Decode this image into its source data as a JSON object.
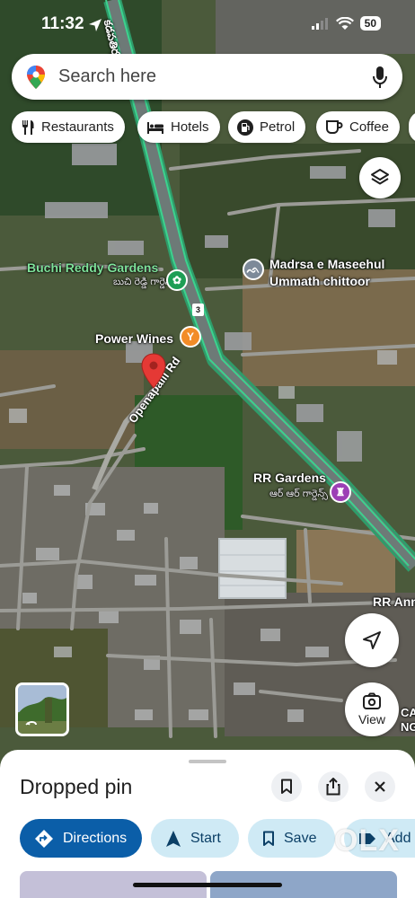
{
  "status_bar": {
    "time": "11:32",
    "battery": "50"
  },
  "search": {
    "placeholder": "Search here"
  },
  "chips": [
    {
      "label": "Restaurants",
      "icon": "fork-knife-icon"
    },
    {
      "label": "Hotels",
      "icon": "bed-icon"
    },
    {
      "label": "Petrol",
      "icon": "fuel-pump-icon"
    },
    {
      "label": "Coffee",
      "icon": "coffee-cup-icon"
    }
  ],
  "map": {
    "labels": {
      "buchi_reddy_gardens": "Buchi Reddy Gardens",
      "buchi_reddy_gardens_te": "బుచి రెడ్డి గార్డెన్స్",
      "madrsa_line1": "Madrsa e Maseehul",
      "madrsa_line2": "Ummath chittoor",
      "power_wines": "Power Wines",
      "openapalli_rd": "Openapalli Rd",
      "rr_gardens": "RR Gardens",
      "rr_gardens_te": "ఆర్ ఆర్ గార్డెన్స్",
      "rr_ann": "RR Ann",
      "highway_te": "కడపతిర్పతి రోడ్",
      "route_shield": "3",
      "edge_right": "CA",
      "edge_right2": "NG"
    },
    "colors": {
      "highway": "#3cd28e",
      "pin": "#e53935",
      "wines_poi": "#f28c28",
      "park_poi": "#1e9e55",
      "venue_poi": "#9c3fb5",
      "mosque_poi": "#7d8a99"
    }
  },
  "buttons": {
    "view_label": "View"
  },
  "sheet": {
    "title": "Dropped pin",
    "actions": {
      "directions": "Directions",
      "start": "Start",
      "save": "Save",
      "add": "Add"
    }
  },
  "watermark": "OLX"
}
